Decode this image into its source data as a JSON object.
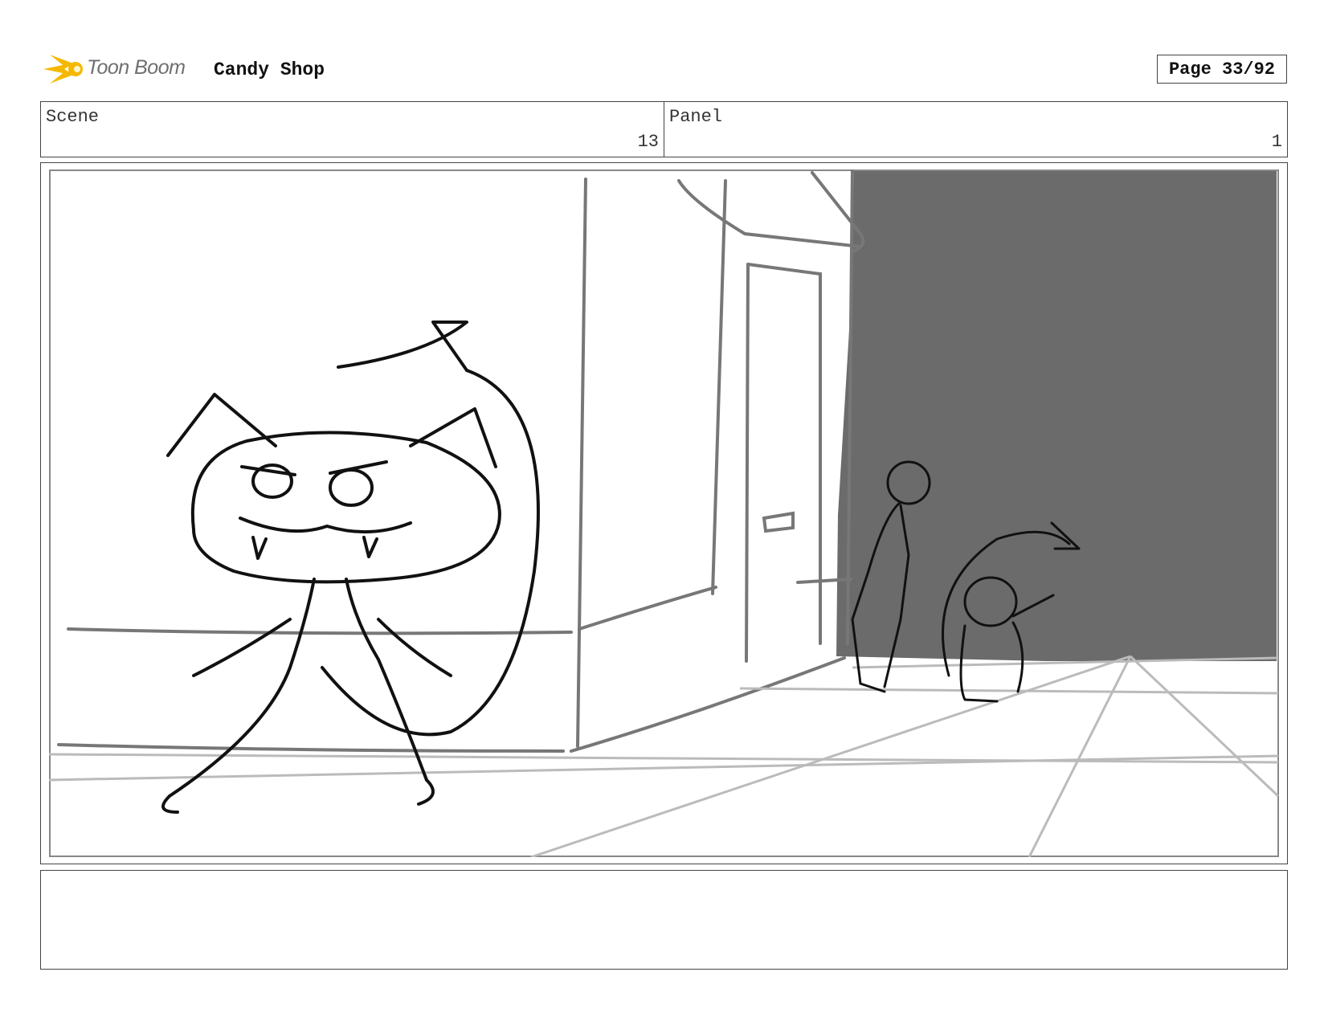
{
  "header": {
    "logo_text": "Toon Boom",
    "project_title": "Candy Shop",
    "page_label": "Page 33/92"
  },
  "info": {
    "scene_label": "Scene",
    "scene_value": "13",
    "panel_label": "Panel",
    "panel_value": "1"
  },
  "panel": {
    "description": "",
    "background_color": "#ffffff",
    "shadow_color": "#6b6b6b"
  },
  "notes": {
    "text": ""
  },
  "colors": {
    "logo_flame": "#f5b800",
    "logo_text": "#6f6f6f",
    "border": "#444444"
  }
}
